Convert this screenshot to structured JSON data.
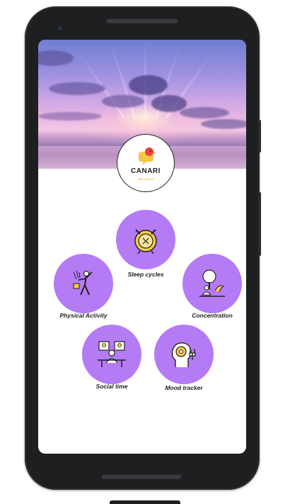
{
  "app": {
    "brand": "CANARI",
    "brand_sub": "WELLNESS"
  },
  "features": [
    {
      "id": "sleep",
      "label": "Sleep cycles",
      "icon": "alarm-clock-icon"
    },
    {
      "id": "physical",
      "label": "Physical Activity",
      "icon": "person-exercise-icon"
    },
    {
      "id": "concentration",
      "label": "Concentration",
      "icon": "meditation-tree-icon"
    },
    {
      "id": "social",
      "label": "Social time",
      "icon": "video-call-people-icon"
    },
    {
      "id": "mood",
      "label": "Mood tracker",
      "icon": "head-plug-icon"
    }
  ],
  "colors": {
    "accent": "#b57bf5",
    "icon_yellow": "#f5c94a",
    "phone_frame": "#1e1f21"
  }
}
